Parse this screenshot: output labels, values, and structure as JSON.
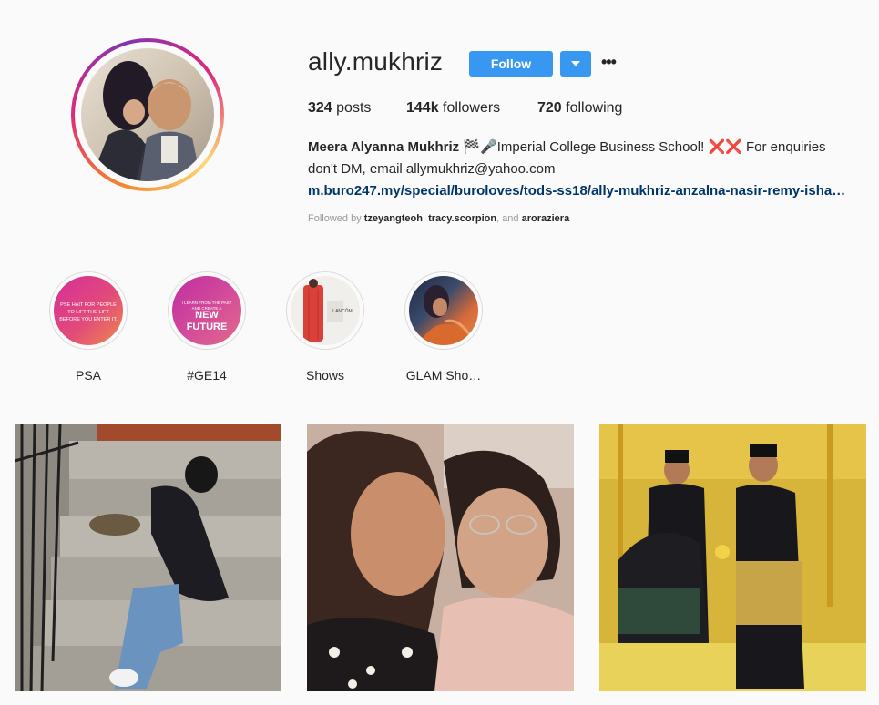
{
  "profile": {
    "username": "ally.mukhriz",
    "follow_label": "Follow",
    "more_glyph": "•••",
    "posts_count": "324",
    "posts_label": "posts",
    "followers_count": "144k",
    "followers_label": "followers",
    "following_count": "720",
    "following_label": "following",
    "full_name": "Meera Alyanna Mukhriz",
    "bio_line1_rest": " 🏁🎤Imperial College Business School! ❌❌ For enquiries",
    "bio_line2": "don't DM, email allymukhriz@yahoo.com",
    "link": "m.buro247.my/special/buroloves/tods-ss18/ally-mukhriz-anzalna-nasir-remy-isha…",
    "followed_by_prefix": "Followed by ",
    "followed_by_1": "tzeyangteoh",
    "followed_by_sep": ", ",
    "followed_by_2": "tracy.scorpion",
    "followed_by_and": ", and ",
    "followed_by_3": "aroraziera"
  },
  "highlights": [
    {
      "label": "PSA",
      "cover_text": "PSE HAIT FOR PEOPLE TO LIFT THE LIFT BEFORE YOU ENTER IT."
    },
    {
      "label": "#GE14",
      "cover_text_small": "I LEARN FROM THE PAST AND CREATE A",
      "cover_text_big": "NEW FUTURE"
    },
    {
      "label": "Shows",
      "cover_text": "LANCÔM"
    },
    {
      "label": "GLAM Sho…"
    }
  ],
  "colors": {
    "accent": "#3897f0",
    "link": "#003569",
    "muted": "#999999",
    "background": "#fafafa"
  }
}
